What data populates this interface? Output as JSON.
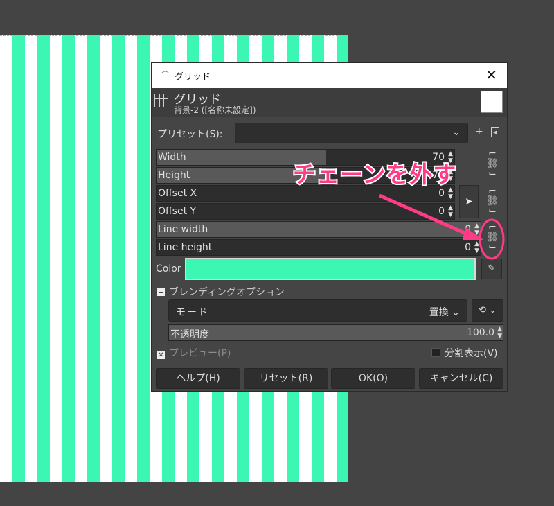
{
  "dialog": {
    "window_title": "グリッド",
    "close_glyph": "✕",
    "header_title": "グリッド",
    "header_subtitle": "背景-2 ([名称未設定])"
  },
  "preset": {
    "label": "プリセット(S):",
    "value": "",
    "add_glyph": "+",
    "menu_glyph": "◂"
  },
  "fields": {
    "width": {
      "label": "Width",
      "value": "70",
      "fill": 0.57
    },
    "height": {
      "label": "Height",
      "value": "70",
      "fill": 0.57
    },
    "offset_x": {
      "label": "Offset X",
      "value": "0",
      "fill": 0.0
    },
    "offset_y": {
      "label": "Offset Y",
      "value": "0",
      "fill": 0.0
    },
    "line_width": {
      "label": "Line width",
      "value": "0",
      "fill": 1.0
    },
    "line_height": {
      "label": "Line height",
      "value": "0",
      "fill": 0.0
    }
  },
  "color": {
    "label": "Color",
    "value": "#3cf7b4"
  },
  "blending": {
    "header": "ブレンディングオプション",
    "mode_label": "モード",
    "mode_value": "置換 ⌄",
    "mode_button": "⟲ ⌄",
    "opacity_label": "不透明度",
    "opacity_value": "100.0",
    "opacity_fill": 1.0
  },
  "preview": {
    "label": "プレビュー(P)",
    "checked": true
  },
  "split_view": {
    "label": "分割表示(V)",
    "checked": false
  },
  "buttons": {
    "help": "ヘルプ(H)",
    "reset": "リセット(R)",
    "ok": "OK(O)",
    "cancel": "キャンセル(C)"
  },
  "annotation": {
    "text": "チェーンを外す",
    "color": "#ff3b86"
  },
  "canvas": {
    "stripe_color": "#3cf7b4",
    "background_color": "#ffffff"
  }
}
